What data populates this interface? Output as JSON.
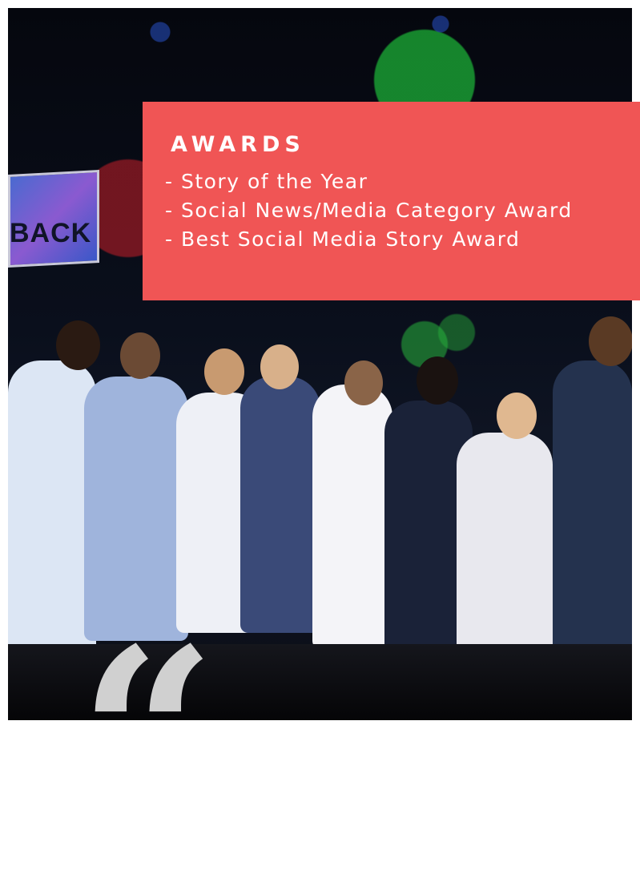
{
  "awards": {
    "title": "AWARDS",
    "items": [
      "- Story of the Year",
      "- Social News/Media Category Award",
      "- Best Social Media Story Award"
    ]
  },
  "photo": {
    "sign_text": "BACK"
  },
  "decor": {
    "quote_glyph": "“"
  },
  "colors": {
    "award_bg": "#f05555",
    "award_text": "#ffffff",
    "quote": "#d0d0d0"
  }
}
